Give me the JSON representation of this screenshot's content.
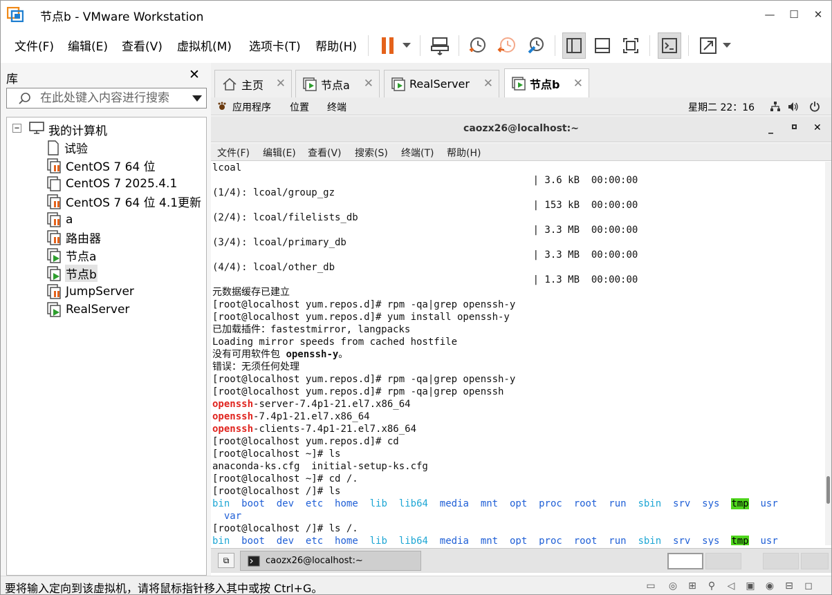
{
  "window": {
    "title": "节点b - VMware Workstation",
    "minimize": "—",
    "maximize": "☐",
    "close": "✕"
  },
  "menus": [
    "文件(F)",
    "编辑(E)",
    "查看(V)",
    "虚拟机(M)",
    "选项卡(T)",
    "帮助(H)"
  ],
  "library": {
    "title": "库",
    "search_placeholder": "在此处键入内容进行搜索",
    "root": "我的计算机",
    "items": [
      {
        "label": "试验",
        "icon": "vm-doc-icon"
      },
      {
        "label": "CentOS 7 64 位",
        "icon": "vm-paused-icon"
      },
      {
        "label": "CentOS 7 2025.4.1",
        "icon": "vm-stopped-icon"
      },
      {
        "label": "CentOS 7 64 位 4.1更新",
        "icon": "vm-paused-icon"
      },
      {
        "label": "a",
        "icon": "vm-paused-icon"
      },
      {
        "label": "路由器",
        "icon": "vm-paused-icon"
      },
      {
        "label": "节点a",
        "icon": "vm-running-icon"
      },
      {
        "label": "节点b",
        "icon": "vm-running-icon"
      },
      {
        "label": "JumpServer",
        "icon": "vm-paused-icon"
      },
      {
        "label": "RealServer",
        "icon": "vm-running-icon"
      }
    ]
  },
  "tabs": [
    {
      "label": "主页",
      "icon": "home-icon"
    },
    {
      "label": "节点a",
      "icon": "vm-running-icon"
    },
    {
      "label": "RealServer",
      "icon": "vm-running-icon"
    },
    {
      "label": "节点b",
      "icon": "vm-running-icon",
      "active": true
    }
  ],
  "guest": {
    "topbar": {
      "apps": "应用程序",
      "places": "位置",
      "terminal": "终端",
      "clock": "星期二 22：16"
    },
    "terminal_title": "caozx26@localhost:~",
    "terminal_menu": [
      "文件(F)",
      "编辑(E)",
      "查看(V)",
      "搜索(S)",
      "终端(T)",
      "帮助(H)"
    ],
    "lines": [
      [
        [
          "lcoal",
          ""
        ]
      ],
      [
        [
          "                                                       | 3.6 kB  00:00:00",
          ""
        ]
      ],
      [
        [
          "(1/4): lcoal/group_gz",
          ""
        ]
      ],
      [
        [
          "                                                       | 153 kB  00:00:00",
          ""
        ]
      ],
      [
        [
          "(2/4): lcoal/filelists_db",
          ""
        ]
      ],
      [
        [
          "                                                       | 3.3 MB  00:00:00",
          ""
        ]
      ],
      [
        [
          "(3/4): lcoal/primary_db",
          ""
        ]
      ],
      [
        [
          "                                                       | 3.3 MB  00:00:00",
          ""
        ]
      ],
      [
        [
          "(4/4): lcoal/other_db",
          ""
        ]
      ],
      [
        [
          "                                                       | 1.3 MB  00:00:00",
          ""
        ]
      ],
      [
        [
          "元数据缓存已建立",
          ""
        ]
      ],
      [
        [
          "[root@localhost yum.repos.d]# rpm -qa|grep openssh-y",
          ""
        ]
      ],
      [
        [
          "[root@localhost yum.repos.d]# yum install openssh-y",
          ""
        ]
      ],
      [
        [
          "已加载插件：fastestmirror, langpacks",
          ""
        ]
      ],
      [
        [
          "Loading mirror speeds from cached hostfile",
          ""
        ]
      ],
      [
        [
          "没有可用软件包 ",
          ""
        ],
        [
          "openssh-y",
          "bold"
        ],
        [
          "。",
          ""
        ]
      ],
      [
        [
          "错误：无须任何处理",
          ""
        ]
      ],
      [
        [
          "[root@localhost yum.repos.d]# rpm -qa|grep openssh-y",
          ""
        ]
      ],
      [
        [
          "[root@localhost yum.repos.d]# rpm -qa|grep openssh",
          ""
        ]
      ],
      [
        [
          "openssh",
          "red"
        ],
        [
          "-server-7.4p1-21.el7.x86_64",
          ""
        ]
      ],
      [
        [
          "openssh",
          "red"
        ],
        [
          "-7.4p1-21.el7.x86_64",
          ""
        ]
      ],
      [
        [
          "openssh",
          "red"
        ],
        [
          "-clients-7.4p1-21.el7.x86_64",
          ""
        ]
      ],
      [
        [
          "[root@localhost yum.repos.d]# cd",
          ""
        ]
      ],
      [
        [
          "[root@localhost ~]# ls",
          ""
        ]
      ],
      [
        [
          "anaconda-ks.cfg  initial-setup-ks.cfg",
          ""
        ]
      ],
      [
        [
          "[root@localhost ~]# cd /.",
          ""
        ]
      ],
      [
        [
          "[root@localhost /]# ls",
          ""
        ]
      ],
      [
        [
          "bin",
          "cyan"
        ],
        [
          "  ",
          ""
        ],
        [
          "boot",
          "blue"
        ],
        [
          "  ",
          ""
        ],
        [
          "dev",
          "blue"
        ],
        [
          "  ",
          ""
        ],
        [
          "etc",
          "blue"
        ],
        [
          "  ",
          ""
        ],
        [
          "home",
          "blue"
        ],
        [
          "  ",
          ""
        ],
        [
          "lib",
          "cyan"
        ],
        [
          "  ",
          ""
        ],
        [
          "lib64",
          "cyan"
        ],
        [
          "  ",
          ""
        ],
        [
          "media",
          "blue"
        ],
        [
          "  ",
          ""
        ],
        [
          "mnt",
          "blue"
        ],
        [
          "  ",
          ""
        ],
        [
          "opt",
          "blue"
        ],
        [
          "  ",
          ""
        ],
        [
          "proc",
          "blue"
        ],
        [
          "  ",
          ""
        ],
        [
          "root",
          "blue"
        ],
        [
          "  ",
          ""
        ],
        [
          "run",
          "blue"
        ],
        [
          "  ",
          ""
        ],
        [
          "sbin",
          "cyan"
        ],
        [
          "  ",
          ""
        ],
        [
          "srv",
          "blue"
        ],
        [
          "  ",
          ""
        ],
        [
          "sys",
          "blue"
        ],
        [
          "  ",
          ""
        ],
        [
          "tmp",
          "tmp"
        ],
        [
          "  ",
          ""
        ],
        [
          "usr",
          "blue"
        ]
      ],
      [
        [
          "  ",
          ""
        ],
        [
          "var",
          "blue"
        ]
      ],
      [
        [
          "[root@localhost /]# ls /.",
          ""
        ]
      ],
      [
        [
          "bin",
          "cyan"
        ],
        [
          "  ",
          ""
        ],
        [
          "boot",
          "blue"
        ],
        [
          "  ",
          ""
        ],
        [
          "dev",
          "blue"
        ],
        [
          "  ",
          ""
        ],
        [
          "etc",
          "blue"
        ],
        [
          "  ",
          ""
        ],
        [
          "home",
          "blue"
        ],
        [
          "  ",
          ""
        ],
        [
          "lib",
          "cyan"
        ],
        [
          "  ",
          ""
        ],
        [
          "lib64",
          "cyan"
        ],
        [
          "  ",
          ""
        ],
        [
          "media",
          "blue"
        ],
        [
          "  ",
          ""
        ],
        [
          "mnt",
          "blue"
        ],
        [
          "  ",
          ""
        ],
        [
          "opt",
          "blue"
        ],
        [
          "  ",
          ""
        ],
        [
          "proc",
          "blue"
        ],
        [
          "  ",
          ""
        ],
        [
          "root",
          "blue"
        ],
        [
          "  ",
          ""
        ],
        [
          "run",
          "blue"
        ],
        [
          "  ",
          ""
        ],
        [
          "sbin",
          "cyan"
        ],
        [
          "  ",
          ""
        ],
        [
          "srv",
          "blue"
        ],
        [
          "  ",
          ""
        ],
        [
          "sys",
          "blue"
        ],
        [
          "  ",
          ""
        ],
        [
          "tmp",
          "tmp"
        ],
        [
          "  ",
          ""
        ],
        [
          "usr",
          "blue"
        ]
      ]
    ],
    "taskbar_item": "caozx26@localhost:~"
  },
  "status": {
    "text": "要将输入定向到该虚拟机，请将鼠标指针移入其中或按 Ctrl+G。"
  },
  "colors": {
    "vm_running": "#2e9e2e",
    "vm_paused": "#e4621b",
    "pause_button": "#e4621b",
    "openssh_red": "#e0241e",
    "dir_blue": "#1f5fd6",
    "link_cyan": "#1da6d4",
    "tmp_bg": "#4ed51c"
  }
}
